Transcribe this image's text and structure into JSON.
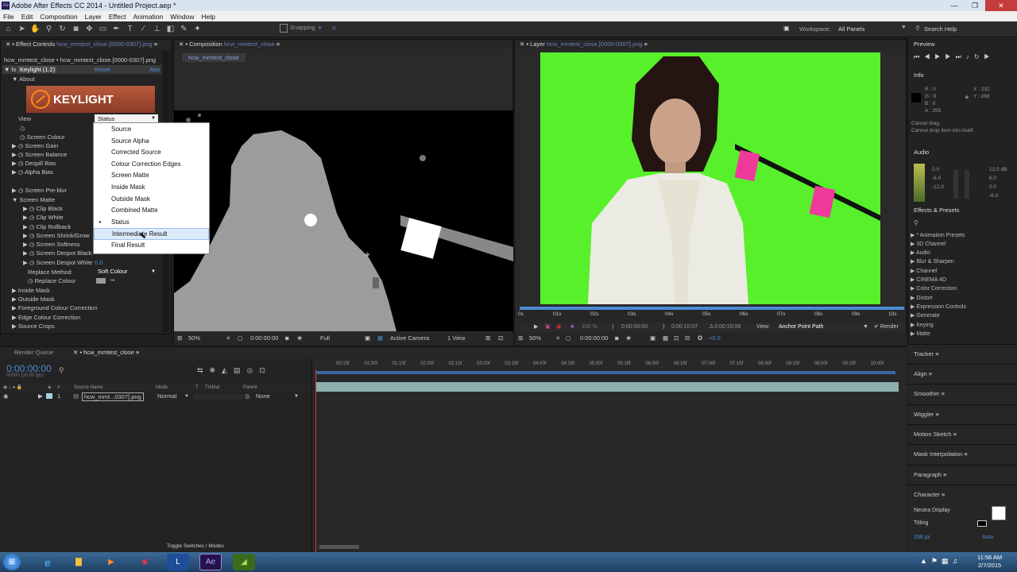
{
  "window": {
    "title": "Adobe After Effects CC 2014 - Untitled Project.aep *"
  },
  "menu": [
    "File",
    "Edit",
    "Composition",
    "Layer",
    "Effect",
    "Animation",
    "Window",
    "Help"
  ],
  "toolbar": {
    "snapping": "Snapping",
    "workspace_label": "Workspace:",
    "workspace_value": "All Panels",
    "search": "Search Help"
  },
  "effect_controls": {
    "tab_label": "Effect Controls",
    "tab_file": "hcw_mmtest_close.[0000-0307].png",
    "breadcrumb": "hcw_mmtest_close • hcw_mmtest_close.[0000-0307].png",
    "effect_name": "Keylight (1.2)",
    "reset": "Reset",
    "about_short": "Abo",
    "about": "About",
    "logo": "KEYLIGHT",
    "view_label": "View",
    "view_value": "Status",
    "props": [
      "Screen Colour",
      "Screen Gain",
      "Screen Balance",
      "Despill Bias",
      "Alpha Bias"
    ],
    "preblur": "Screen Pre-blur",
    "screen_matte": "Screen Matte",
    "matte_props": [
      "Clip Black",
      "Clip White",
      "Clip Rollback",
      "Screen Shrink/Grow",
      "Screen Softness",
      "Screen Despot Black",
      "Screen Despot White"
    ],
    "despot_white_value": "0.0",
    "replace_method_label": "Replace Method",
    "replace_method_value": "Soft Colour",
    "replace_colour": "Replace Colour",
    "groups": [
      "Inside Mask",
      "Outside Mask",
      "Foreground Colour Correction",
      "Edge Colour Correction",
      "Source Crops"
    ]
  },
  "view_dropdown": {
    "options": [
      "Source",
      "Source Alpha",
      "Corrected Source",
      "Colour Correction Edges",
      "Screen Matte",
      "Inside Mask",
      "Outside Mask",
      "Combined Matte",
      "Status",
      "Intermediate Result",
      "Final Result"
    ],
    "selected": "Status",
    "hovered": "Intermediate Result"
  },
  "composition": {
    "tab_label": "Composition",
    "tab_name": "hcw_mmtest_close",
    "subtab": "hcw_mmtest_close",
    "zoom": "50%",
    "time": "0:00:00:00",
    "resolution": "Full",
    "camera": "Active Camera",
    "views": "1 View"
  },
  "layer": {
    "tab_label": "Layer",
    "tab_name": "hcw_mmtest_close.[0000-0307].png",
    "ruler": [
      "0s",
      "01s",
      "02s",
      "03s",
      "04s",
      "05s",
      "06s",
      "07s",
      "08s",
      "09s",
      "10s"
    ],
    "time_in": "0:00:00:00",
    "time_out": "0:00:10:07",
    "duration": "Δ 0:00:10:08",
    "view_label": "View:",
    "view_value": "Anchor Point Path",
    "render": "Render",
    "zoom": "50%",
    "time": "0:00:00:00",
    "exposure": "+0.0",
    "opacity": "100 %"
  },
  "preview": {
    "title": "Preview"
  },
  "info": {
    "title": "Info",
    "r": "R : 0",
    "g": "G : 0",
    "b": "B : 0",
    "a": "A : 255",
    "x": "X : 232",
    "y": "Y : 268",
    "msg1": "Cancel drag.",
    "msg2": "Cannot drop item into itself."
  },
  "audio": {
    "title": "Audio",
    "left": [
      "0.0",
      "-6.0",
      "-12.0"
    ],
    "right": [
      "12.0 dB",
      "6.0",
      "0.0",
      "-6.0"
    ]
  },
  "effects_presets": {
    "title": "Effects & Presets",
    "items": [
      "* Animation Presets",
      "3D Channel",
      "Audio",
      "Blur & Sharpen",
      "Channel",
      "CINEMA 4D",
      "Color Correction",
      "Distort",
      "Expression Controls",
      "Generate",
      "Keying",
      "Matte"
    ]
  },
  "right_panels": [
    "Tracker",
    "Align",
    "Smoother",
    "Wiggler",
    "Motion Sketch",
    "Mask Interpolation",
    "Paragraph",
    "Character"
  ],
  "character": {
    "font": "Neutra Display",
    "style": "Titling",
    "size": "198 px",
    "auto": "Auto"
  },
  "timeline": {
    "render_queue": "Render Queue",
    "comp_tab": "hcw_mmtest_close",
    "timecode": "0:00:00:00",
    "fps": "00000 (30.00 fps)",
    "col_source": "Source Name",
    "col_mode": "Mode",
    "col_t": "T",
    "col_trkmat": "TrkMat",
    "col_parent": "Parent",
    "layer_num": "1",
    "layer_name": "hcw_mmt...0307].png",
    "layer_mode": "Normal",
    "layer_parent": "None",
    "ruler": [
      "00:15f",
      "01:00f",
      "01:15f",
      "02:00f",
      "02:15f",
      "03:00f",
      "03:15f",
      "04:00f",
      "04:15f",
      "05:00f",
      "05:15f",
      "06:00f",
      "06:15f",
      "07:00f",
      "07:15f",
      "08:00f",
      "08:15f",
      "09:00f",
      "09:15f",
      "10:00f"
    ],
    "toggle": "Toggle Switches / Modes"
  },
  "taskbar": {
    "time": "11:56 AM",
    "date": "2/7/2015"
  }
}
